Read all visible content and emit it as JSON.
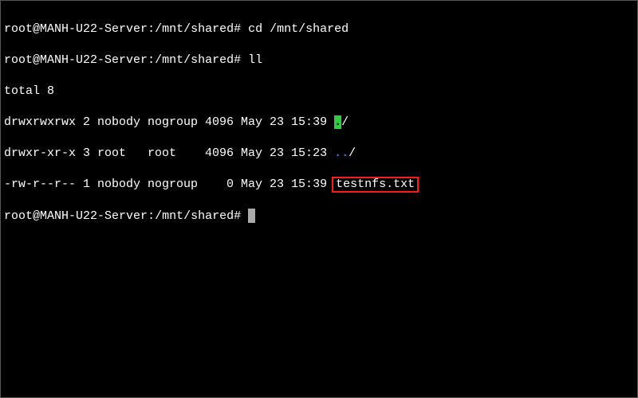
{
  "prompt": {
    "user": "root",
    "host": "MANH-U22-Server",
    "path": "/mnt/shared",
    "symbol": "#"
  },
  "lines": {
    "cmd1": "cd /mnt/shared",
    "cmd2": "ll",
    "total": "total 8",
    "row1": {
      "perms": "drwxrwxrwx 2 nobody nogroup 4096 May 23 15:39 ",
      "name": ".",
      "suffix": "/"
    },
    "row2": {
      "perms": "drwxr-xr-x 3 root   root    4096 May 23 15:23 ",
      "name": "..",
      "suffix": "/"
    },
    "row3": {
      "perms": "-rw-r--r-- 1 nobody nogroup    0 May 23 15:39 ",
      "name": "testnfs.txt"
    }
  }
}
